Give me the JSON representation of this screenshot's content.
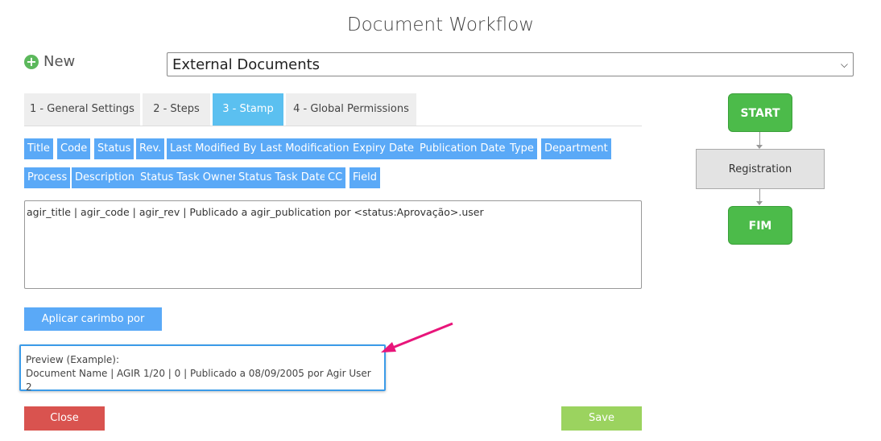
{
  "page": {
    "title": "Document Workflow"
  },
  "toolbar": {
    "new_label": "New",
    "new_icon": "plus-circle-icon"
  },
  "workflow_select": {
    "selected": "External Documents"
  },
  "tabs": [
    {
      "label": "1 - General Settings",
      "active": false
    },
    {
      "label": "2 - Steps",
      "active": false
    },
    {
      "label": "3 - Stamp",
      "active": true
    },
    {
      "label": "4 - Global Permissions",
      "active": false
    }
  ],
  "stamp_tags": [
    "Title",
    "Code",
    "Status",
    "Rev.",
    "Last Modified By",
    "Last Modification",
    "Expiry Date",
    "Publication Date",
    "Type",
    "Department",
    "Process",
    "Description",
    "Status Task Owner",
    "Status Task Date",
    "CC",
    "Field"
  ],
  "stamp": {
    "value": "agir_title | agir_code | agir_rev | Publicado a agir_publication por <status:Aprovação>.user"
  },
  "apply_default_label": "Aplicar carimbo por defeito",
  "preview": {
    "heading": "Preview (Example):",
    "text": "Document Name | AGIR 1/20 | 0 | Publicado a 08/09/2005 por Agir User 2"
  },
  "buttons": {
    "close": "Close",
    "save": "Save"
  },
  "diagram": {
    "start": "START",
    "step": "Registration",
    "end": "FIM"
  },
  "colors": {
    "tab_active": "#5bc0f0",
    "tag": "#5aa9f7",
    "close": "#d9534f",
    "save": "#9bd35f",
    "node_green": "#4cbb4a",
    "annotation_arrow": "#e8157a",
    "preview_border": "#3b9be8"
  }
}
